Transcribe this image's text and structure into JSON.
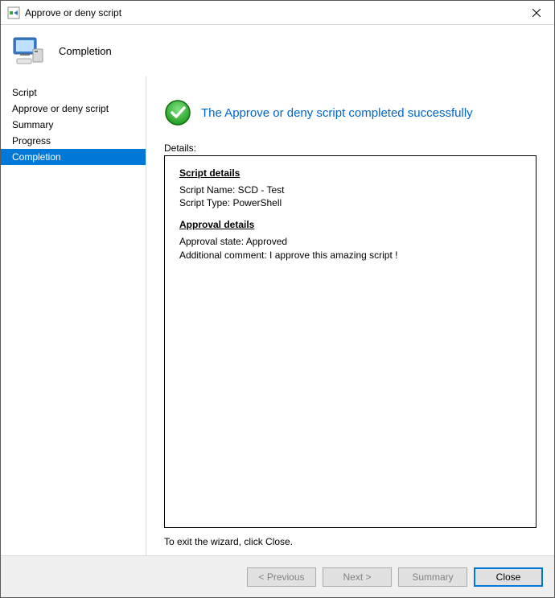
{
  "window": {
    "title": "Approve or deny script"
  },
  "header": {
    "title": "Completion"
  },
  "sidebar": {
    "items": [
      {
        "label": "Script",
        "active": false
      },
      {
        "label": "Approve or deny script",
        "active": false
      },
      {
        "label": "Summary",
        "active": false
      },
      {
        "label": "Progress",
        "active": false
      },
      {
        "label": "Completion",
        "active": true
      }
    ]
  },
  "main": {
    "success_text": "The Approve or deny script completed successfully",
    "details_label": "Details:",
    "script_details_heading": "Script details",
    "script_name_line": "Script Name: SCD - Test",
    "script_type_line": "Script Type: PowerShell",
    "approval_details_heading": "Approval details",
    "approval_state_line": "Approval state: Approved",
    "additional_comment_line": "Additional comment: I approve this amazing script !",
    "exit_hint": "To exit the wizard, click Close."
  },
  "footer": {
    "previous": "< Previous",
    "next": "Next >",
    "summary": "Summary",
    "close": "Close"
  }
}
